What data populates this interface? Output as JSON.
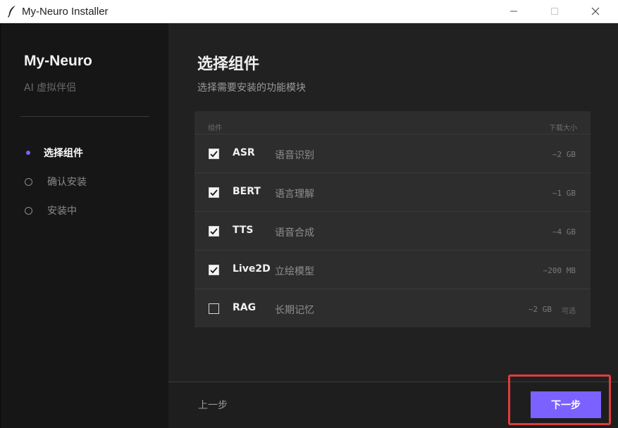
{
  "window": {
    "title": "My-Neuro Installer",
    "icons": {
      "app": "feather-icon",
      "minimize": "minimize-icon",
      "maximize": "maximize-icon",
      "close": "close-icon"
    }
  },
  "sidebar": {
    "brand": "My-Neuro",
    "subtitle": "AI 虚拟伴侣",
    "steps": [
      {
        "label": "选择组件",
        "state": "active"
      },
      {
        "label": "确认安装",
        "state": "pending"
      },
      {
        "label": "安装中",
        "state": "pending"
      }
    ]
  },
  "main": {
    "title": "选择组件",
    "subtitle": "选择需要安装的功能模块",
    "table": {
      "header_left": "组件",
      "header_right": "下载大小",
      "rows": [
        {
          "name": "ASR",
          "desc": "语音识别",
          "size": "~2 GB",
          "checked": true
        },
        {
          "name": "BERT",
          "desc": "语言理解",
          "size": "~1 GB",
          "checked": true
        },
        {
          "name": "TTS",
          "desc": "语音合成",
          "size": "~4 GB",
          "checked": true
        },
        {
          "name": "Live2D",
          "desc": "立绘模型",
          "size": "~200 MB",
          "checked": true
        },
        {
          "name": "RAG",
          "desc": "长期记忆",
          "size": "~2 GB",
          "checked": false,
          "tag": "可选"
        }
      ]
    }
  },
  "footer": {
    "prev_label": "上一步",
    "next_label": "下一步"
  },
  "colors": {
    "accent": "#7b61ff",
    "highlight": "#e23b3b",
    "sidebar_bg": "#161616",
    "main_bg": "#212121",
    "panel_bg": "#2d2d2d"
  }
}
